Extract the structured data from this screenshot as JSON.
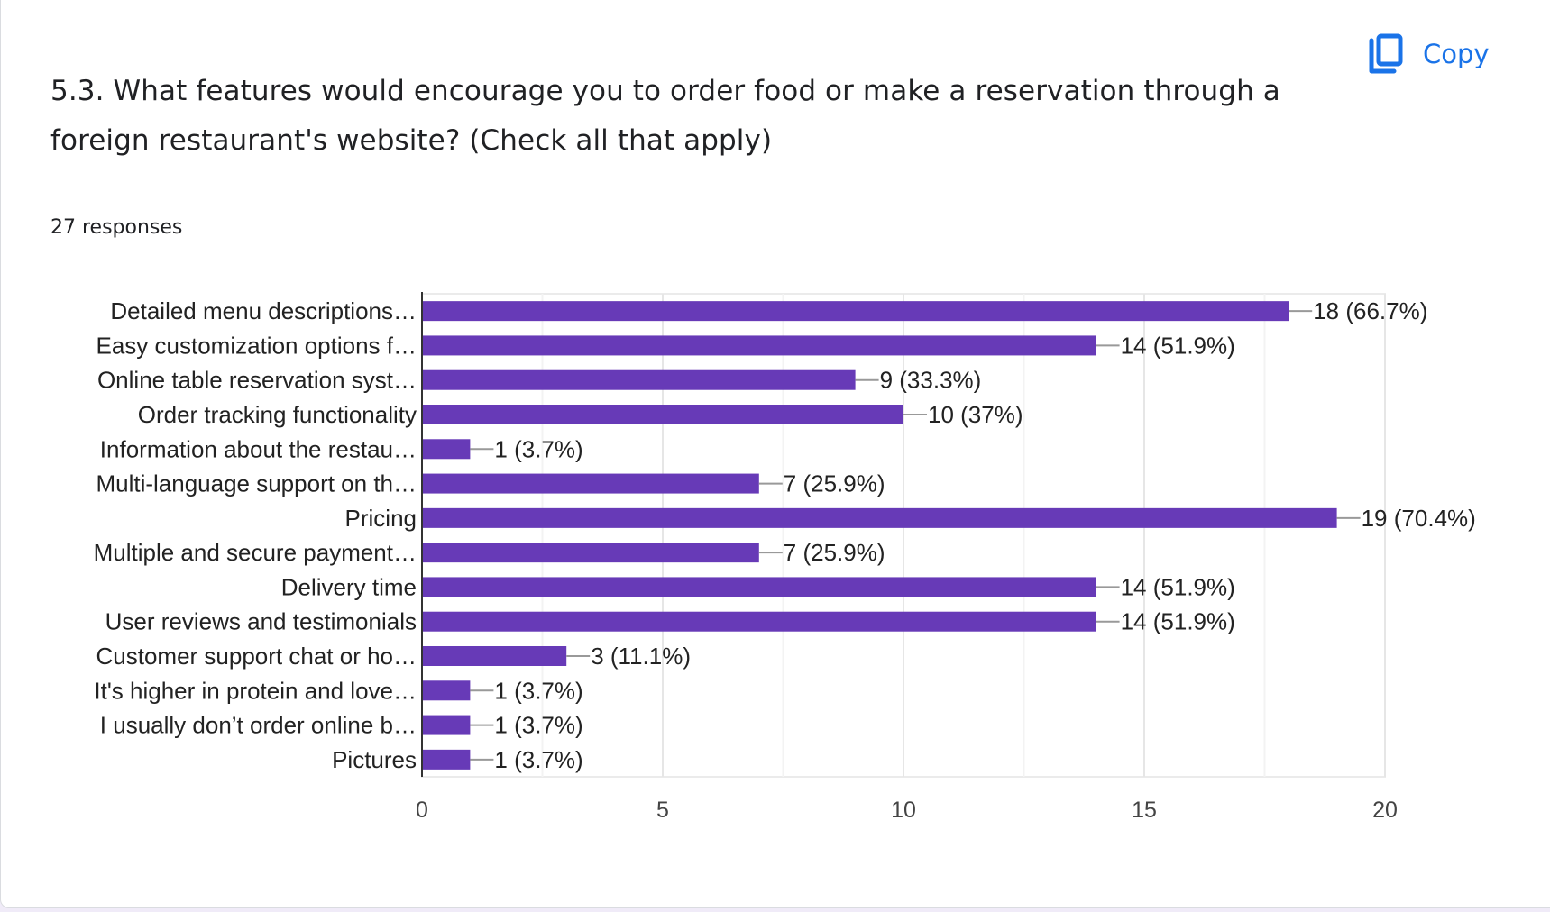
{
  "question": {
    "title": "5.3. What features would encourage you to order food or make a reservation through a foreign restaurant's website? (Check all that apply)",
    "responses": "27 responses"
  },
  "actions": {
    "copy_label": "Copy",
    "copy_icon": "copy-icon"
  },
  "colors": {
    "bar": "#673ab7",
    "accent": "#1a73e8"
  },
  "chart_data": {
    "type": "bar",
    "orientation": "horizontal",
    "title": "",
    "xlabel": "",
    "ylabel": "",
    "xlim": [
      0,
      20
    ],
    "xticks": [
      0,
      5,
      10,
      15,
      20
    ],
    "grid": true,
    "categories": [
      "Detailed menu descriptions…",
      "Easy customization options f…",
      "Online table reservation syst…",
      "Order tracking functionality",
      "Information about the restau…",
      "Multi-language support on th…",
      "Pricing",
      "Multiple and secure payment…",
      "Delivery time",
      "User reviews and testimonials",
      "Customer support chat or ho…",
      "It's higher in protein and love…",
      "I usually don’t order online b…",
      "Pictures"
    ],
    "values": [
      18,
      14,
      9,
      10,
      1,
      7,
      19,
      7,
      14,
      14,
      3,
      1,
      1,
      1
    ],
    "value_labels": [
      "18 (66.7%)",
      "14 (51.9%)",
      "9 (33.3%)",
      "10 (37%)",
      "1 (3.7%)",
      "7 (25.9%)",
      "19 (70.4%)",
      "7 (25.9%)",
      "14 (51.9%)",
      "14 (51.9%)",
      "3 (11.1%)",
      "1 (3.7%)",
      "1 (3.7%)",
      "1 (3.7%)"
    ]
  }
}
